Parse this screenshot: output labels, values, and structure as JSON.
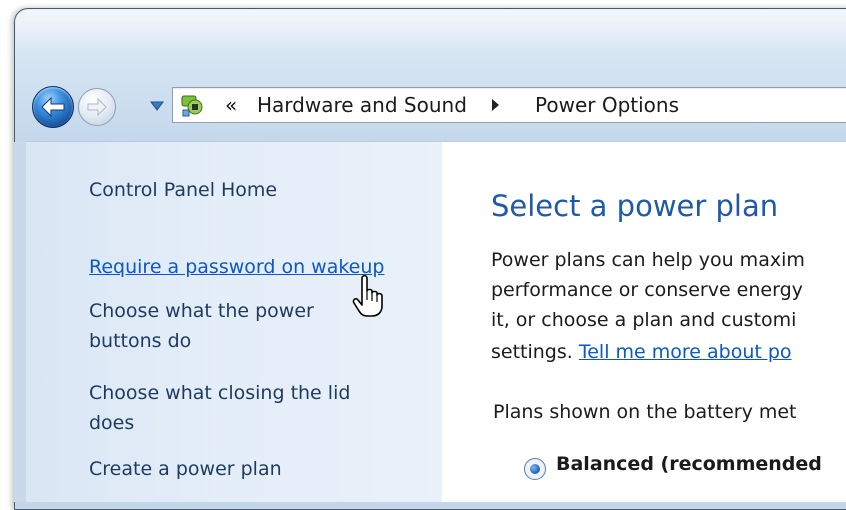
{
  "nav": {
    "back_label": "Back",
    "forward_label": "Forward"
  },
  "address": {
    "overflow_chevron": "«",
    "crumbs": [
      "Hardware and Sound",
      "Power Options"
    ]
  },
  "sidebar": {
    "home": "Control Panel Home",
    "links": [
      "Require a password on wakeup",
      "Choose what the power",
      "buttons do",
      "Choose what closing the lid",
      "does",
      "Create a power plan"
    ]
  },
  "main": {
    "title": "Select a power plan",
    "desc_lines": [
      "Power plans can help you maxim",
      "performance or conserve energy",
      "it, or choose a plan and customi",
      "settings. "
    ],
    "tell_more_link": "Tell me more about po",
    "plans_shown": "Plans shown on the battery met",
    "selected_plan": "Balanced (recommended"
  },
  "colors": {
    "link": "#0a58ca",
    "title": "#1e5aa8",
    "sidebar_bg": "#e3edf8"
  }
}
